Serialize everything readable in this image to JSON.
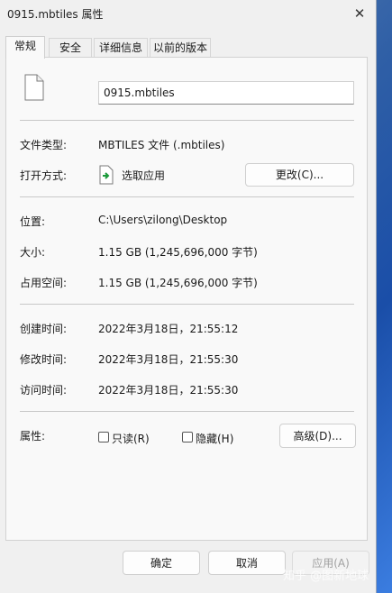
{
  "window": {
    "title": "0915.mbtiles 属性",
    "close_glyph": "✕"
  },
  "tabs": [
    {
      "label": "常规",
      "active": true
    },
    {
      "label": "安全",
      "active": false
    },
    {
      "label": "详细信息",
      "active": false
    },
    {
      "label": "以前的版本",
      "active": false
    }
  ],
  "general": {
    "file_name": "0915.mbtiles",
    "file_type_label": "文件类型:",
    "file_type_value": "MBTILES 文件 (.mbtiles)",
    "open_with_label": "打开方式:",
    "open_with_value": "选取应用",
    "change_button": "更改(C)...",
    "location_label": "位置:",
    "location_value": "C:\\Users\\zilong\\Desktop",
    "size_label": "大小:",
    "size_value": "1.15 GB (1,245,696,000 字节)",
    "size_on_disk_label": "占用空间:",
    "size_on_disk_value": "1.15 GB (1,245,696,000 字节)",
    "created_label": "创建时间:",
    "created_value": "2022年3月18日，21:55:12",
    "modified_label": "修改时间:",
    "modified_value": "2022年3月18日，21:55:30",
    "accessed_label": "访问时间:",
    "accessed_value": "2022年3月18日，21:55:30",
    "attributes_label": "属性:",
    "readonly_label": "只读(R)",
    "hidden_label": "隐藏(H)",
    "advanced_button": "高级(D)..."
  },
  "footer": {
    "ok": "确定",
    "cancel": "取消",
    "apply": "应用(A)"
  },
  "watermark": "知乎 @图新地球",
  "colors": {
    "accent": "#2f5fa6",
    "panel": "#f9f9f9",
    "window": "#f0f0f0"
  }
}
